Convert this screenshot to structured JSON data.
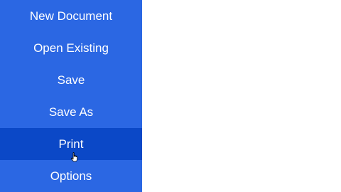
{
  "menu": {
    "items": [
      {
        "label": "New Document"
      },
      {
        "label": "Open Existing"
      },
      {
        "label": "Save"
      },
      {
        "label": "Save As"
      },
      {
        "label": "Print"
      },
      {
        "label": "Options"
      }
    ],
    "selected_index": 4
  },
  "colors": {
    "menu_background": "#2b67e3",
    "selected_background": "#0b48c7",
    "text": "#ffffff",
    "content_background": "#ffffff"
  },
  "icons": {
    "cursor": "hand-pointer-icon"
  }
}
